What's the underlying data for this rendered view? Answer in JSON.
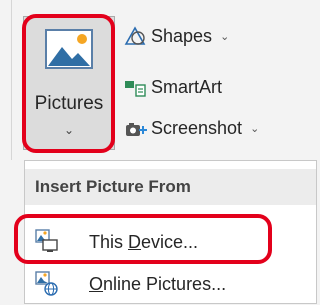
{
  "ribbon": {
    "pictures": {
      "label": "Pictures",
      "chevron": "⌄"
    },
    "commands": [
      {
        "label": "Shapes",
        "caret": "⌄",
        "icon": "shapes-icon"
      },
      {
        "label": "SmartArt",
        "caret": "",
        "icon": "smartart-icon"
      },
      {
        "label": "Screenshot",
        "caret": "⌄",
        "icon": "screenshot-icon"
      }
    ]
  },
  "menu": {
    "header": "Insert Picture From",
    "items": [
      {
        "pre": "This ",
        "accel": "D",
        "post": "evice...",
        "icon": "this-device-icon"
      },
      {
        "pre": "",
        "accel": "O",
        "post": "nline Pictures...",
        "icon": "online-pictures-icon"
      }
    ]
  },
  "colors": {
    "highlight": "#e3001b",
    "accent_blue": "#2b88d8",
    "sun": "#f5a623"
  }
}
